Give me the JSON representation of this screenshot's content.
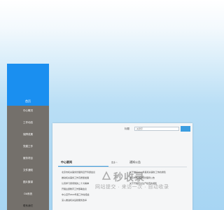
{
  "sidebar": {
    "home_label": "首页",
    "items": [
      {
        "label": "中心概况"
      },
      {
        "label": "工作动态"
      },
      {
        "label": "保障成果"
      },
      {
        "label": "党建工作"
      },
      {
        "label": "服务项目"
      },
      {
        "label": "文件通知"
      },
      {
        "label": "图片集锦"
      },
      {
        "label": "OA系统"
      },
      {
        "label": "联系我们"
      }
    ]
  },
  "search": {
    "label": "标题",
    "placeholder": "关键字"
  },
  "tabs": {
    "center": "中心要闻",
    "notice": "通知公告",
    "more": "更多 >"
  },
  "news": [
    "北京市机关事务管理局召开专题会议",
    "推动机关事务工作高质量发展",
    "认真学习贯彻党的二十大精神",
    "开展主题教育工作部署会议",
    "中心召开2023年度工作总结会",
    "深入推进机关后勤服务改革"
  ],
  "notices": [
    "关于做好2023年度机关事务工作的通知",
    "北京市机关事务管理局公告",
    "关于开展安全生产检查的通知"
  ],
  "watermark": {
    "title": "秒收录",
    "slogan": "网站提交 · 来访一次 · 自动收录"
  },
  "colors": {
    "accent": "#1a8ff0",
    "menu_bg": "#74706b"
  }
}
